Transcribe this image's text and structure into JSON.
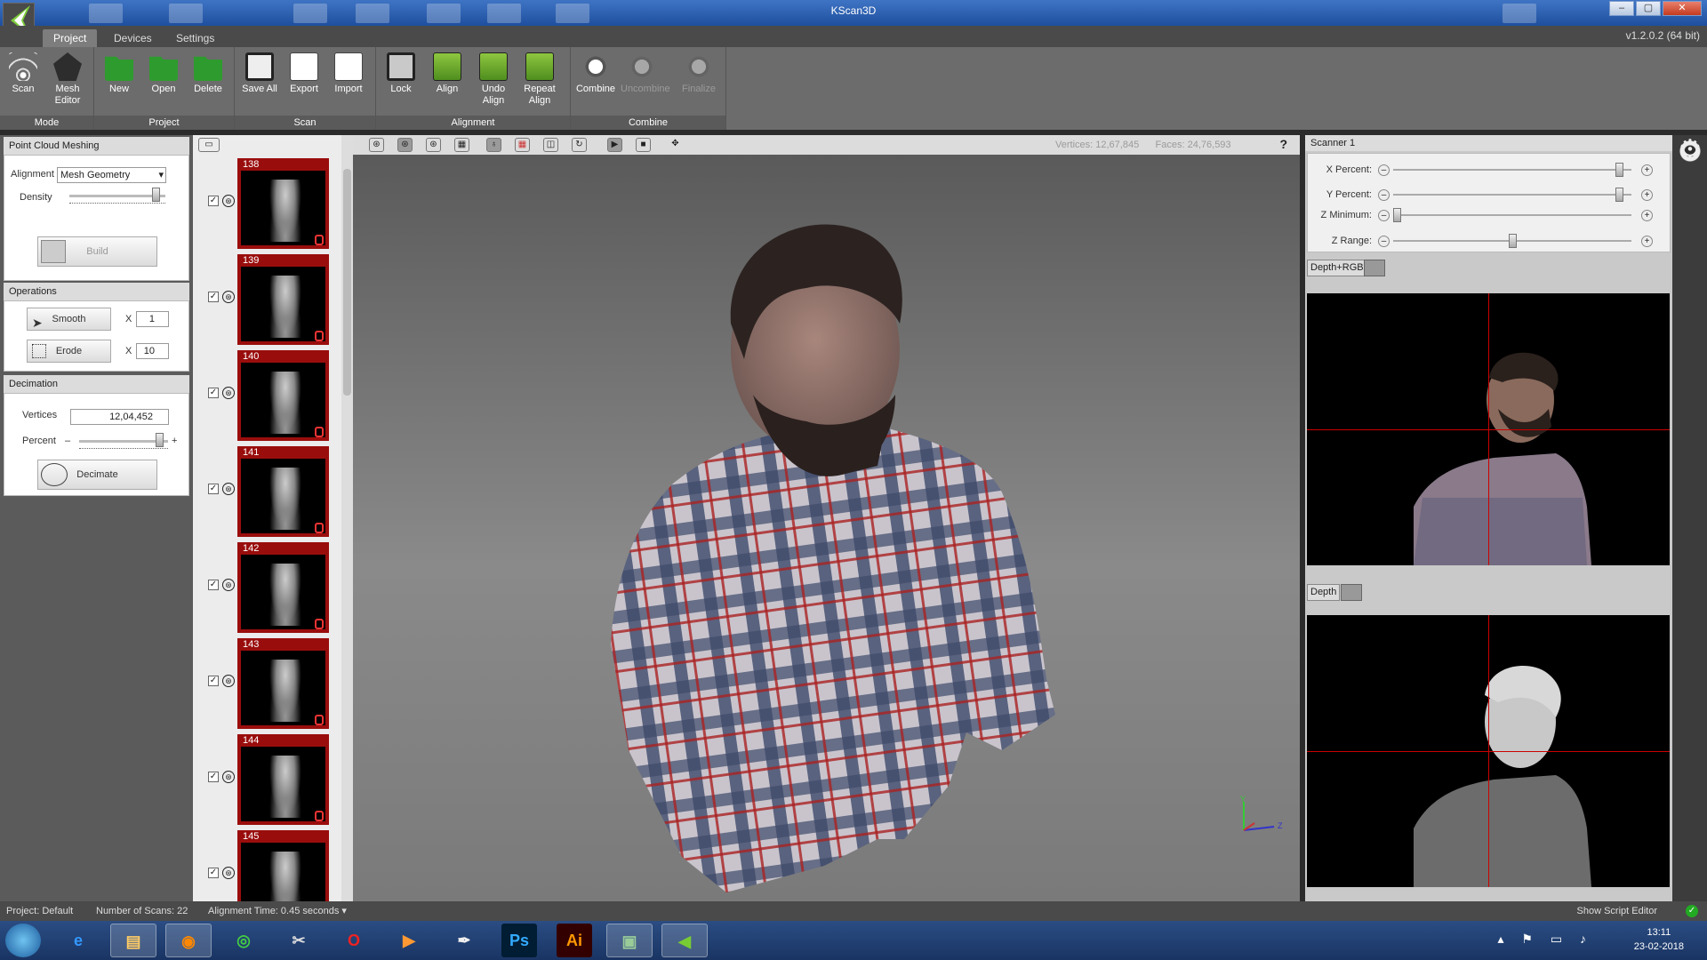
{
  "window": {
    "title": "KScan3D",
    "version": "v1.2.0.2  (64 bit)",
    "controls": [
      "–",
      "▢",
      "✕"
    ]
  },
  "menu_tabs": [
    "Project",
    "Devices",
    "Settings"
  ],
  "ribbon": {
    "mode": {
      "label": "Mode",
      "buttons": [
        "Scan",
        "Mesh Editor"
      ]
    },
    "project": {
      "label": "Project",
      "buttons": [
        "New",
        "Open",
        "Delete"
      ]
    },
    "scan": {
      "label": "Scan",
      "buttons": [
        "Save All",
        "Export",
        "Import"
      ]
    },
    "alignment": {
      "label": "Alignment",
      "buttons": [
        "Lock",
        "Align",
        "Undo Align",
        "Repeat Align"
      ]
    },
    "combine": {
      "label": "Combine",
      "buttons": [
        "Combine",
        "Uncombine",
        "Finalize"
      ]
    }
  },
  "left_panel": {
    "point_cloud": {
      "title": "Point Cloud Meshing",
      "alignment_label": "Alignment",
      "alignment_value": "Mesh Geometry",
      "density_label": "Density",
      "build_label": "Build"
    },
    "operations": {
      "title": "Operations",
      "smooth_label": "Smooth",
      "smooth_x": "X",
      "smooth_value": "1",
      "erode_label": "Erode",
      "erode_x": "X",
      "erode_value": "10"
    },
    "decimation": {
      "title": "Decimation",
      "vertices_label": "Vertices",
      "vertices_value": "12,04,452",
      "percent_label": "Percent",
      "minus": "–",
      "plus": "+",
      "decimate_label": "Decimate"
    }
  },
  "scan_list": [
    {
      "num": "138",
      "checked": "✓"
    },
    {
      "num": "139",
      "checked": "✓"
    },
    {
      "num": "140",
      "checked": "✓"
    },
    {
      "num": "141",
      "checked": "✓"
    },
    {
      "num": "142",
      "checked": "✓"
    },
    {
      "num": "143",
      "checked": "✓"
    },
    {
      "num": "144",
      "checked": "✓"
    },
    {
      "num": "145",
      "checked": "✓"
    }
  ],
  "viewport": {
    "vertices_label": "Vertices:",
    "vertices_value": "12,67,845",
    "faces_label": "Faces:",
    "faces_value": "24,76,593",
    "help": "?",
    "axes": {
      "y": "Y",
      "z": "Z"
    }
  },
  "right_panel": {
    "scanner_title": "Scanner 1",
    "sliders": [
      {
        "label": "X Percent:",
        "value": 0.96
      },
      {
        "label": "Y Percent:",
        "value": 0.96
      },
      {
        "label": "Z Minimum:",
        "value": 0.0
      },
      {
        "label": "Z Range:",
        "value": 0.5
      }
    ],
    "view1_tab": "Depth+RGB",
    "view2_tab": "Depth"
  },
  "status": {
    "project": "Project:  Default",
    "scans": "Number of Scans:  22",
    "align_time": "Alignment Time:  0.45 seconds",
    "script_editor": "Show Script Editor"
  },
  "taskbar": {
    "apps": [
      "start-orb",
      "ie",
      "explorer",
      "firefox",
      "chrome",
      "paint",
      "opera",
      "media",
      "inkscape",
      "Ps",
      "Ai",
      "monitor",
      "kscan3d"
    ],
    "time": "13:11",
    "date": "23-02-2018"
  },
  "colors": {
    "thumb_bg": "#9a0d0d",
    "crosshair": "#cc0000",
    "ribbon_bg": "#6c6c6c",
    "taskbar": "#193463"
  }
}
